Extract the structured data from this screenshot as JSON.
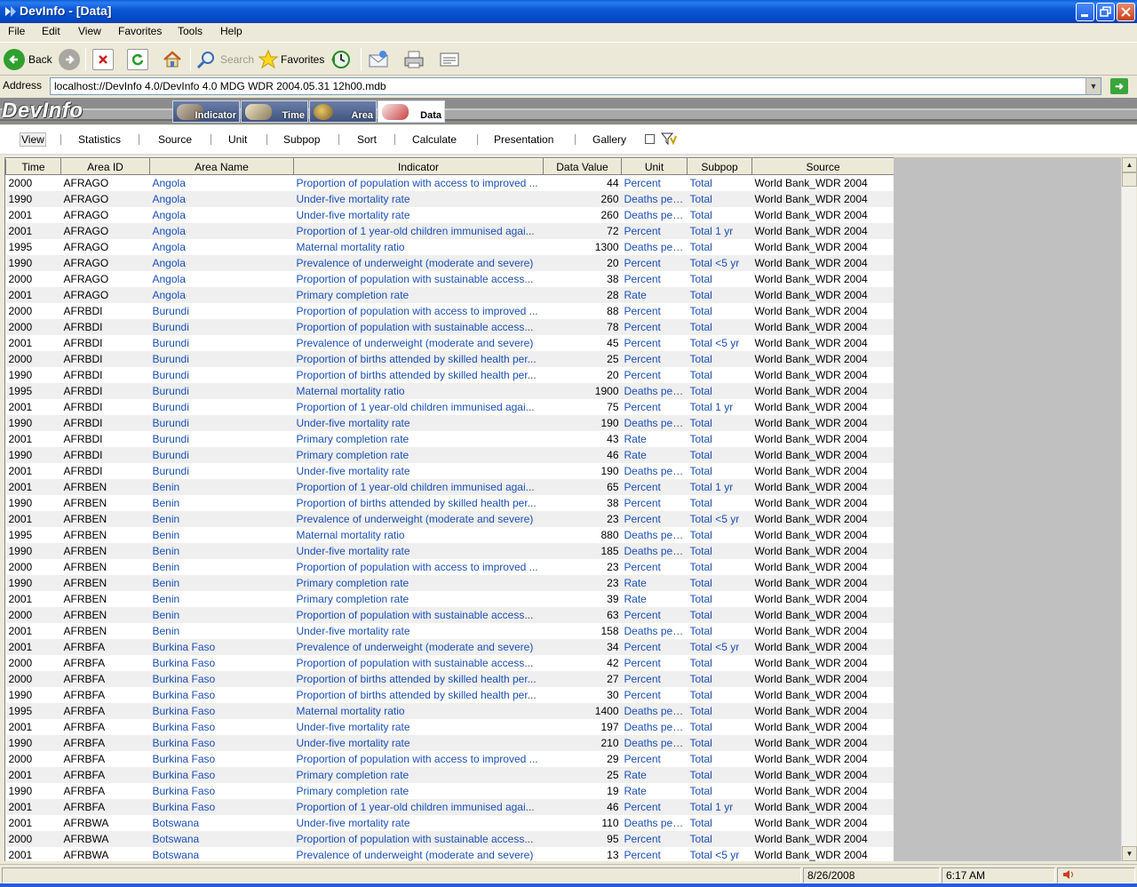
{
  "window": {
    "title": "DevInfo - [Data]"
  },
  "menu": [
    "File",
    "Edit",
    "View",
    "Favorites",
    "Tools",
    "Help"
  ],
  "toolbar": {
    "back": "Back",
    "search": "Search",
    "favorites": "Favorites"
  },
  "address": {
    "label": "Address",
    "value": "localhost://DevInfo 4.0/DevInfo 4.0 MDG WDR 2004.05.31 12h00.mdb"
  },
  "devinfo": {
    "logo": "DevInfo",
    "tabs": [
      "Indicator",
      "Time",
      "Area",
      "Data"
    ],
    "active_tab": "Data"
  },
  "subtoolbar": [
    "View",
    "Statistics",
    "Source",
    "Unit",
    "Subpop",
    "Sort",
    "Calculate",
    "Presentation",
    "Gallery"
  ],
  "grid": {
    "columns": [
      "Time",
      "Area ID",
      "Area Name",
      "Indicator",
      "Data Value",
      "Unit",
      "Subpop",
      "Source"
    ],
    "rows": [
      [
        "2000",
        "AFRAGO",
        "Angola",
        "Proportion of population with access to improved ...",
        "44",
        "Percent",
        "Total",
        "World Bank_WDR 2004"
      ],
      [
        "1990",
        "AFRAGO",
        "Angola",
        "Under-five mortality rate",
        "260",
        "Deaths per...",
        "Total",
        "World Bank_WDR 2004"
      ],
      [
        "2001",
        "AFRAGO",
        "Angola",
        "Under-five mortality rate",
        "260",
        "Deaths per...",
        "Total",
        "World Bank_WDR 2004"
      ],
      [
        "2001",
        "AFRAGO",
        "Angola",
        "Proportion of 1 year-old children immunised agai...",
        "72",
        "Percent",
        "Total 1 yr",
        "World Bank_WDR 2004"
      ],
      [
        "1995",
        "AFRAGO",
        "Angola",
        "Maternal mortality ratio",
        "1300",
        "Deaths per...",
        "Total",
        "World Bank_WDR 2004"
      ],
      [
        "1990",
        "AFRAGO",
        "Angola",
        "Prevalence of underweight (moderate and severe)",
        "20",
        "Percent",
        "Total <5 yr",
        "World Bank_WDR 2004"
      ],
      [
        "2000",
        "AFRAGO",
        "Angola",
        "Proportion of population with sustainable access...",
        "38",
        "Percent",
        "Total",
        "World Bank_WDR 2004"
      ],
      [
        "2001",
        "AFRAGO",
        "Angola",
        "Primary completion rate",
        "28",
        "Rate",
        "Total",
        "World Bank_WDR 2004"
      ],
      [
        "2000",
        "AFRBDI",
        "Burundi",
        "Proportion of population with access to improved ...",
        "88",
        "Percent",
        "Total",
        "World Bank_WDR 2004"
      ],
      [
        "2000",
        "AFRBDI",
        "Burundi",
        "Proportion of population with sustainable access...",
        "78",
        "Percent",
        "Total",
        "World Bank_WDR 2004"
      ],
      [
        "2001",
        "AFRBDI",
        "Burundi",
        "Prevalence of underweight (moderate and severe)",
        "45",
        "Percent",
        "Total <5 yr",
        "World Bank_WDR 2004"
      ],
      [
        "2000",
        "AFRBDI",
        "Burundi",
        "Proportion of births attended by skilled health per...",
        "25",
        "Percent",
        "Total",
        "World Bank_WDR 2004"
      ],
      [
        "1990",
        "AFRBDI",
        "Burundi",
        "Proportion of births attended by skilled health per...",
        "20",
        "Percent",
        "Total",
        "World Bank_WDR 2004"
      ],
      [
        "1995",
        "AFRBDI",
        "Burundi",
        "Maternal mortality ratio",
        "1900",
        "Deaths per...",
        "Total",
        "World Bank_WDR 2004"
      ],
      [
        "2001",
        "AFRBDI",
        "Burundi",
        "Proportion of 1 year-old children immunised agai...",
        "75",
        "Percent",
        "Total 1 yr",
        "World Bank_WDR 2004"
      ],
      [
        "1990",
        "AFRBDI",
        "Burundi",
        "Under-five mortality rate",
        "190",
        "Deaths per...",
        "Total",
        "World Bank_WDR 2004"
      ],
      [
        "2001",
        "AFRBDI",
        "Burundi",
        "Primary completion rate",
        "43",
        "Rate",
        "Total",
        "World Bank_WDR 2004"
      ],
      [
        "1990",
        "AFRBDI",
        "Burundi",
        "Primary completion rate",
        "46",
        "Rate",
        "Total",
        "World Bank_WDR 2004"
      ],
      [
        "2001",
        "AFRBDI",
        "Burundi",
        "Under-five mortality rate",
        "190",
        "Deaths per...",
        "Total",
        "World Bank_WDR 2004"
      ],
      [
        "2001",
        "AFRBEN",
        "Benin",
        "Proportion of 1 year-old children immunised agai...",
        "65",
        "Percent",
        "Total 1 yr",
        "World Bank_WDR 2004"
      ],
      [
        "1990",
        "AFRBEN",
        "Benin",
        "Proportion of births attended by skilled health per...",
        "38",
        "Percent",
        "Total",
        "World Bank_WDR 2004"
      ],
      [
        "2001",
        "AFRBEN",
        "Benin",
        "Prevalence of underweight (moderate and severe)",
        "23",
        "Percent",
        "Total <5 yr",
        "World Bank_WDR 2004"
      ],
      [
        "1995",
        "AFRBEN",
        "Benin",
        "Maternal mortality ratio",
        "880",
        "Deaths per...",
        "Total",
        "World Bank_WDR 2004"
      ],
      [
        "1990",
        "AFRBEN",
        "Benin",
        "Under-five mortality rate",
        "185",
        "Deaths per...",
        "Total",
        "World Bank_WDR 2004"
      ],
      [
        "2000",
        "AFRBEN",
        "Benin",
        "Proportion of population with access to improved ...",
        "23",
        "Percent",
        "Total",
        "World Bank_WDR 2004"
      ],
      [
        "1990",
        "AFRBEN",
        "Benin",
        "Primary completion rate",
        "23",
        "Rate",
        "Total",
        "World Bank_WDR 2004"
      ],
      [
        "2001",
        "AFRBEN",
        "Benin",
        "Primary completion rate",
        "39",
        "Rate",
        "Total",
        "World Bank_WDR 2004"
      ],
      [
        "2000",
        "AFRBEN",
        "Benin",
        "Proportion of population with sustainable access...",
        "63",
        "Percent",
        "Total",
        "World Bank_WDR 2004"
      ],
      [
        "2001",
        "AFRBEN",
        "Benin",
        "Under-five mortality rate",
        "158",
        "Deaths per...",
        "Total",
        "World Bank_WDR 2004"
      ],
      [
        "2001",
        "AFRBFA",
        "Burkina Faso",
        "Prevalence of underweight (moderate and severe)",
        "34",
        "Percent",
        "Total <5 yr",
        "World Bank_WDR 2004"
      ],
      [
        "2000",
        "AFRBFA",
        "Burkina Faso",
        "Proportion of population with sustainable access...",
        "42",
        "Percent",
        "Total",
        "World Bank_WDR 2004"
      ],
      [
        "2000",
        "AFRBFA",
        "Burkina Faso",
        "Proportion of births attended by skilled health per...",
        "27",
        "Percent",
        "Total",
        "World Bank_WDR 2004"
      ],
      [
        "1990",
        "AFRBFA",
        "Burkina Faso",
        "Proportion of births attended by skilled health per...",
        "30",
        "Percent",
        "Total",
        "World Bank_WDR 2004"
      ],
      [
        "1995",
        "AFRBFA",
        "Burkina Faso",
        "Maternal mortality ratio",
        "1400",
        "Deaths per...",
        "Total",
        "World Bank_WDR 2004"
      ],
      [
        "2001",
        "AFRBFA",
        "Burkina Faso",
        "Under-five mortality rate",
        "197",
        "Deaths per...",
        "Total",
        "World Bank_WDR 2004"
      ],
      [
        "1990",
        "AFRBFA",
        "Burkina Faso",
        "Under-five mortality rate",
        "210",
        "Deaths per...",
        "Total",
        "World Bank_WDR 2004"
      ],
      [
        "2000",
        "AFRBFA",
        "Burkina Faso",
        "Proportion of population with access to improved ...",
        "29",
        "Percent",
        "Total",
        "World Bank_WDR 2004"
      ],
      [
        "2001",
        "AFRBFA",
        "Burkina Faso",
        "Primary completion rate",
        "25",
        "Rate",
        "Total",
        "World Bank_WDR 2004"
      ],
      [
        "1990",
        "AFRBFA",
        "Burkina Faso",
        "Primary completion rate",
        "19",
        "Rate",
        "Total",
        "World Bank_WDR 2004"
      ],
      [
        "2001",
        "AFRBFA",
        "Burkina Faso",
        "Proportion of 1 year-old children immunised agai...",
        "46",
        "Percent",
        "Total 1 yr",
        "World Bank_WDR 2004"
      ],
      [
        "2001",
        "AFRBWA",
        "Botswana",
        "Under-five mortality rate",
        "110",
        "Deaths per...",
        "Total",
        "World Bank_WDR 2004"
      ],
      [
        "2000",
        "AFRBWA",
        "Botswana",
        "Proportion of population with sustainable access...",
        "95",
        "Percent",
        "Total",
        "World Bank_WDR 2004"
      ],
      [
        "2001",
        "AFRBWA",
        "Botswana",
        "Prevalence of underweight (moderate and severe)",
        "13",
        "Percent",
        "Total <5 yr",
        "World Bank_WDR 2004"
      ]
    ]
  },
  "status": {
    "date": "8/26/2008",
    "time": "6:17 AM"
  },
  "colors": {
    "link": "#1a50b4",
    "titlebar": "#0348c4",
    "header_band": "#8c8c8c"
  }
}
